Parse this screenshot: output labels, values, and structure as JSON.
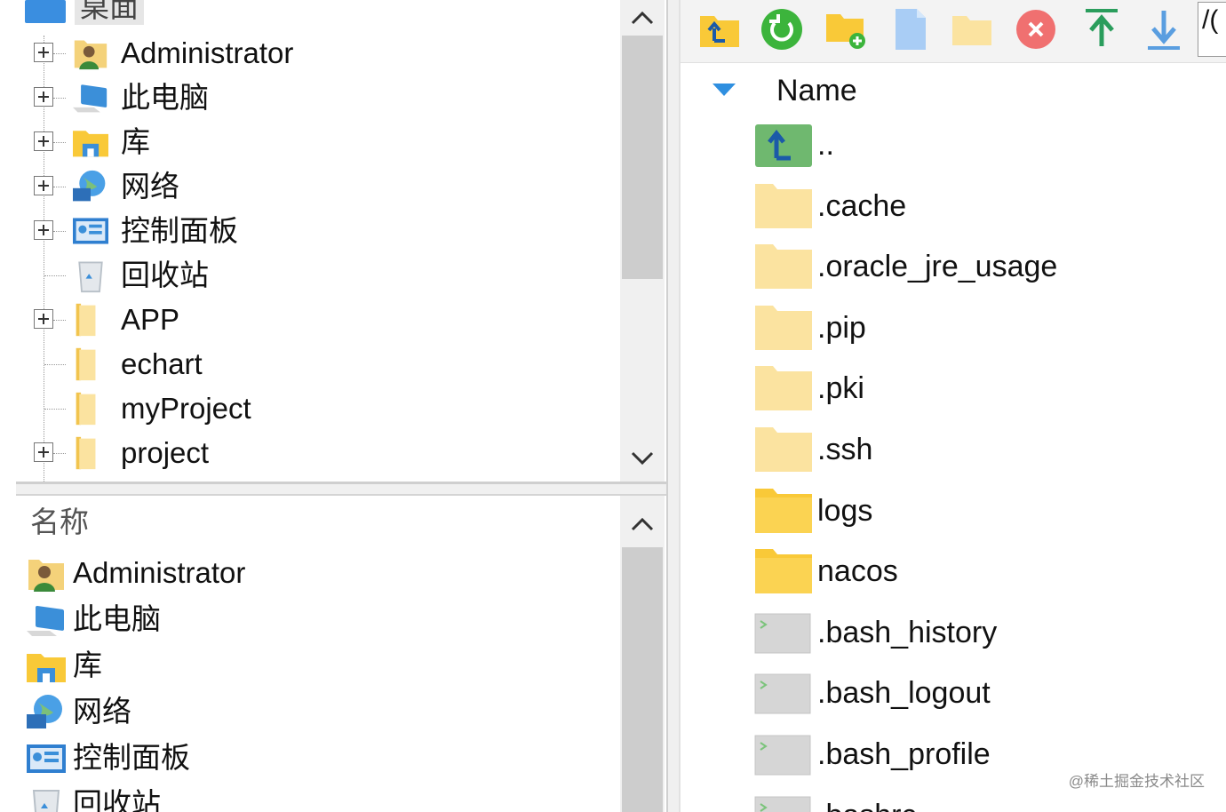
{
  "tree": {
    "root_label": "桌面",
    "items": [
      {
        "label": "Administrator",
        "icon": "user-folder-icon",
        "expandable": true
      },
      {
        "label": "此电脑",
        "icon": "computer-icon",
        "expandable": true
      },
      {
        "label": "库",
        "icon": "library-icon",
        "expandable": true
      },
      {
        "label": "网络",
        "icon": "network-icon",
        "expandable": true
      },
      {
        "label": "控制面板",
        "icon": "control-panel-icon",
        "expandable": true
      },
      {
        "label": "回收站",
        "icon": "recycle-bin-icon",
        "expandable": false
      },
      {
        "label": "APP",
        "icon": "folder-icon",
        "expandable": true
      },
      {
        "label": "echart",
        "icon": "folder-icon",
        "expandable": false
      },
      {
        "label": "myProject",
        "icon": "folder-icon",
        "expandable": false
      },
      {
        "label": "project",
        "icon": "folder-icon",
        "expandable": true
      }
    ]
  },
  "list": {
    "header": "名称",
    "items": [
      {
        "label": "Administrator",
        "icon": "user-folder-icon"
      },
      {
        "label": "此电脑",
        "icon": "computer-icon"
      },
      {
        "label": "库",
        "icon": "library-icon"
      },
      {
        "label": "网络",
        "icon": "network-icon"
      },
      {
        "label": "控制面板",
        "icon": "control-panel-icon"
      },
      {
        "label": "回收站",
        "icon": "recycle-bin-icon"
      }
    ]
  },
  "remote": {
    "toolbar": [
      "parent-directory-icon",
      "refresh-icon",
      "new-folder-icon",
      "new-file-icon",
      "folder-icon",
      "delete-icon",
      "upload-icon",
      "download-icon"
    ],
    "path_fragment": "/(",
    "column_header": "Name",
    "files": [
      {
        "name": "..",
        "type": "parent"
      },
      {
        "name": ".cache",
        "type": "folder-light"
      },
      {
        "name": ".oracle_jre_usage",
        "type": "folder-light"
      },
      {
        "name": ".pip",
        "type": "folder-light"
      },
      {
        "name": ".pki",
        "type": "folder-light"
      },
      {
        "name": ".ssh",
        "type": "folder-light"
      },
      {
        "name": "logs",
        "type": "folder"
      },
      {
        "name": "nacos",
        "type": "folder"
      },
      {
        "name": ".bash_history",
        "type": "shell"
      },
      {
        "name": ".bash_logout",
        "type": "shell"
      },
      {
        "name": ".bash_profile",
        "type": "shell"
      },
      {
        "name": ".bashrc",
        "type": "shell"
      }
    ]
  },
  "watermark": "@稀土掘金技术社区",
  "colors": {
    "folder": "#f9c938",
    "folder_light": "#fbe3a0",
    "refresh": "#3cb43c",
    "delete": "#f07070",
    "upload": "#2a9d5c",
    "download": "#5a9ee0",
    "sort_arrow": "#2f8fe0"
  }
}
